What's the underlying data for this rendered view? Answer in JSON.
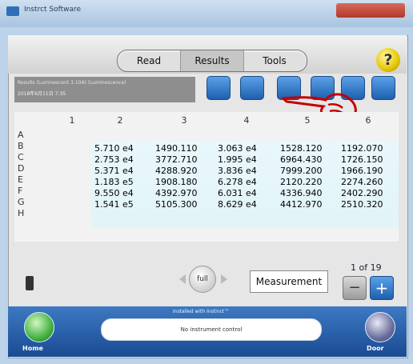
{
  "window": {
    "title": "Instrct Software"
  },
  "tabs": [
    {
      "label": "Read"
    },
    {
      "label": "Results"
    },
    {
      "label": "Tools"
    }
  ],
  "help": {
    "label": "?"
  },
  "header": {
    "line1": "Results (Luminescent   3.10A) (Luminescence)",
    "line2": "2018年6月11日  7:35"
  },
  "toolbar": {
    "buttons": [
      {
        "icon": "export-icon"
      },
      {
        "icon": "table-icon"
      },
      {
        "icon": "window-icon"
      },
      {
        "icon": "email-icon"
      },
      {
        "icon": "dropdown-icon"
      },
      {
        "icon": "folder-icon"
      }
    ]
  },
  "grid": {
    "columns": [
      "1",
      "2",
      "3",
      "4",
      "5",
      "6"
    ],
    "rows": [
      "A",
      "B",
      "C",
      "D",
      "E",
      "F",
      "G",
      "H"
    ],
    "values": [
      [
        "5.710 e4",
        "1490.110",
        "3.063 e4",
        "1528.120",
        "1192.070"
      ],
      [
        "2.753 e4",
        "3772.710",
        "1.995 e4",
        "6964.430",
        "1726.150"
      ],
      [
        "5.371 e4",
        "4288.920",
        "3.836 e4",
        "7999.200",
        "1966.190"
      ],
      [
        "1.183 e5",
        "1908.180",
        "6.278 e4",
        "2120.220",
        "2274.260"
      ],
      [
        "9.550 e4",
        "4392.970",
        "6.031 e4",
        "4336.940",
        "2402.290"
      ],
      [
        "1.541 e5",
        "5105.300",
        "8.629 e4",
        "4412.970",
        "2510.320"
      ]
    ]
  },
  "controls": {
    "full_label": "full",
    "measurement_label": "Measurement",
    "page": {
      "current": "1",
      "of": "of 19"
    },
    "minus": "−",
    "plus": "+"
  },
  "footer": {
    "home_label": "Home",
    "door_label": "Door",
    "installed_text": "Installed with Instinct™",
    "status_text": "No instrument control"
  },
  "colors": {
    "accent": "#1f5fae",
    "footer": "#2a5ea8",
    "cells_bg": "#e5f5f9"
  }
}
